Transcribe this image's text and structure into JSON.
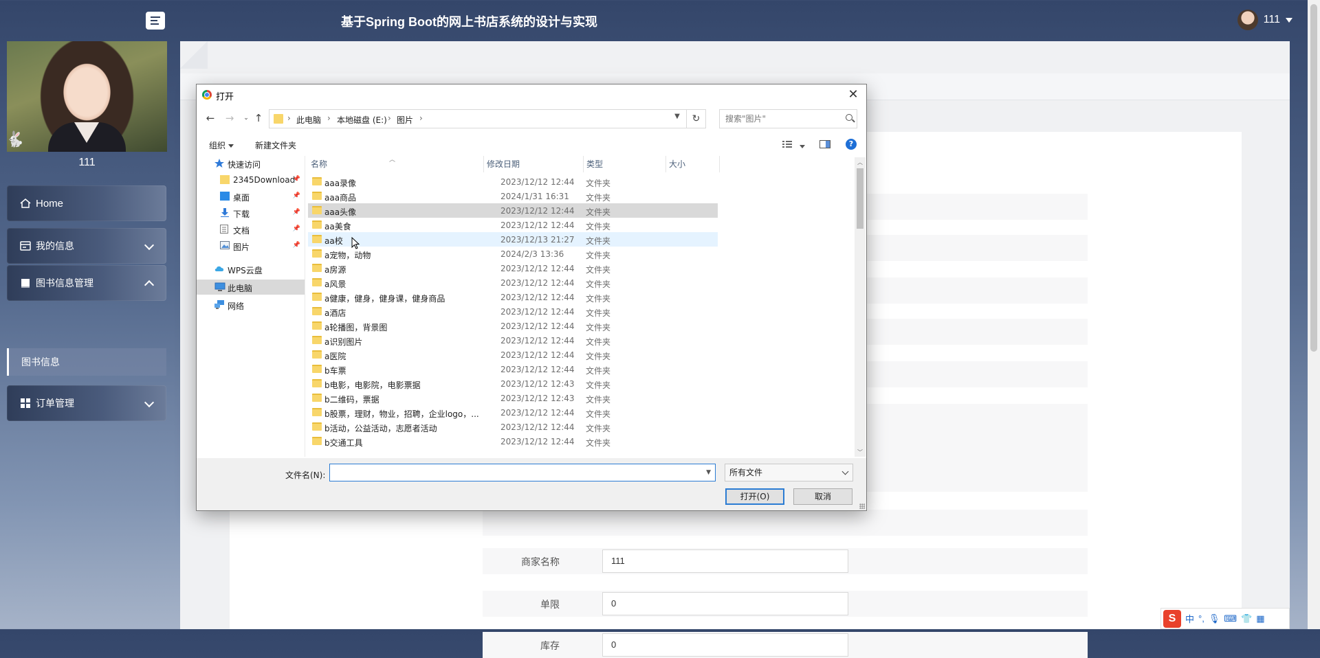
{
  "header": {
    "title": "基于Spring Boot的网上书店系统的设计与实现",
    "username": "111"
  },
  "sidebar": {
    "profile_name": "111",
    "items": [
      {
        "label": "Home"
      },
      {
        "label": "我的信息"
      },
      {
        "label": "图书信息管理"
      },
      {
        "label": "订单管理"
      }
    ],
    "sub_item": "图书信息"
  },
  "form": {
    "fields": [
      {
        "label": "商家名称",
        "value": "111"
      },
      {
        "label": "单限",
        "value": "0"
      },
      {
        "label": "库存",
        "value": "0"
      }
    ]
  },
  "dialog": {
    "title": "打开",
    "breadcrumbs": [
      "此电脑",
      "本地磁盘 (E:)",
      "图片"
    ],
    "search_placeholder": "搜索\"图片\"",
    "toolbar": {
      "organize": "组织",
      "new_folder": "新建文件夹"
    },
    "nav_pane": [
      {
        "label": "快速访问",
        "icon": "star-icon"
      },
      {
        "label": "2345Download",
        "icon": "folder-icon",
        "pinned": true
      },
      {
        "label": "桌面",
        "icon": "desktop-icon",
        "pinned": true
      },
      {
        "label": "下载",
        "icon": "download-icon",
        "pinned": true
      },
      {
        "label": "文档",
        "icon": "document-icon",
        "pinned": true
      },
      {
        "label": "图片",
        "icon": "pictures-icon",
        "pinned": true
      },
      {
        "label": "WPS云盘",
        "icon": "cloud-icon"
      },
      {
        "label": "此电脑",
        "icon": "computer-icon",
        "selected": true
      },
      {
        "label": "网络",
        "icon": "network-icon"
      }
    ],
    "columns": {
      "name": "名称",
      "date": "修改日期",
      "type": "类型",
      "size": "大小"
    },
    "files": [
      {
        "name": "aaa录像",
        "date": "2023/12/12 12:44",
        "type": "文件夹"
      },
      {
        "name": "aaa商品",
        "date": "2024/1/31 16:31",
        "type": "文件夹"
      },
      {
        "name": "aaa头像",
        "date": "2023/12/12 12:44",
        "type": "文件夹",
        "state": "selected"
      },
      {
        "name": "aa美食",
        "date": "2023/12/12 12:44",
        "type": "文件夹"
      },
      {
        "name": "aa校",
        "date": "2023/12/13 21:27",
        "type": "文件夹",
        "state": "hover"
      },
      {
        "name": "a宠物，动物",
        "date": "2024/2/3 13:36",
        "type": "文件夹"
      },
      {
        "name": "a房源",
        "date": "2023/12/12 12:44",
        "type": "文件夹"
      },
      {
        "name": "a风景",
        "date": "2023/12/12 12:44",
        "type": "文件夹"
      },
      {
        "name": "a健康，健身，健身课，健身商品",
        "date": "2023/12/12 12:44",
        "type": "文件夹"
      },
      {
        "name": "a酒店",
        "date": "2023/12/12 12:44",
        "type": "文件夹"
      },
      {
        "name": "a轮播图，背景图",
        "date": "2023/12/12 12:44",
        "type": "文件夹"
      },
      {
        "name": "a识别图片",
        "date": "2023/12/12 12:44",
        "type": "文件夹"
      },
      {
        "name": "a医院",
        "date": "2023/12/12 12:44",
        "type": "文件夹"
      },
      {
        "name": "b车票",
        "date": "2023/12/12 12:44",
        "type": "文件夹"
      },
      {
        "name": "b电影，电影院，电影票据",
        "date": "2023/12/12 12:43",
        "type": "文件夹"
      },
      {
        "name": "b二维码，票据",
        "date": "2023/12/12 12:43",
        "type": "文件夹"
      },
      {
        "name": "b股票，理财，物业，招聘，企业logo，...",
        "date": "2023/12/12 12:44",
        "type": "文件夹"
      },
      {
        "name": "b活动，公益活动，志愿者活动",
        "date": "2023/12/12 12:44",
        "type": "文件夹"
      },
      {
        "name": "b交通工具",
        "date": "2023/12/12 12:44",
        "type": "文件夹"
      }
    ],
    "filename_label": "文件名(N):",
    "filename_value": "",
    "filetype": "所有文件",
    "open_button": "打开(O)",
    "cancel_button": "取消"
  },
  "ime": {
    "mode": "中"
  }
}
